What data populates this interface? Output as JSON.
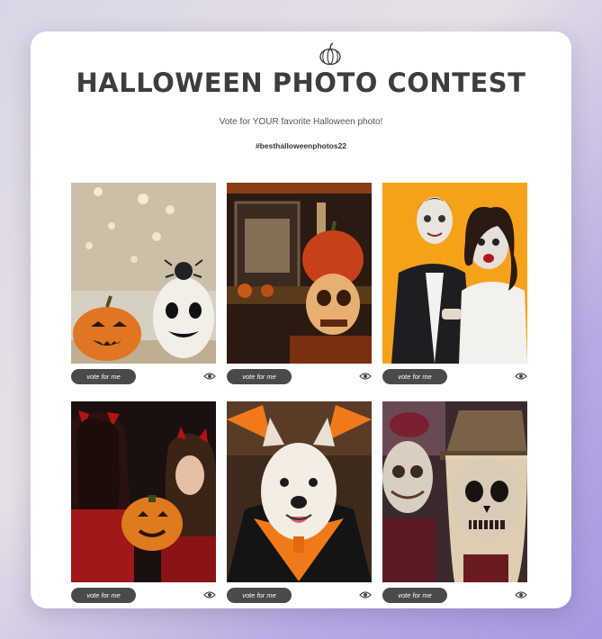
{
  "contest": {
    "title": "HALLOWEEN PHOTO CONTEST",
    "subtitle": "Vote for YOUR favorite Halloween photo!",
    "hashtag": "#besthalloweenphotos22",
    "logo_icon": "pumpkin-icon"
  },
  "entries": [
    {
      "vote_label": "vote for me",
      "view_icon": "eye-icon"
    },
    {
      "vote_label": "vote for me",
      "view_icon": "eye-icon"
    },
    {
      "vote_label": "vote for me",
      "view_icon": "eye-icon"
    },
    {
      "vote_label": "vote for me",
      "view_icon": "eye-icon"
    },
    {
      "vote_label": "vote for me",
      "view_icon": "eye-icon"
    },
    {
      "vote_label": "vote for me",
      "view_icon": "eye-icon"
    }
  ],
  "colors": {
    "title": "#3d3d3d",
    "button": "#4a4a4a",
    "card": "#ffffff"
  }
}
